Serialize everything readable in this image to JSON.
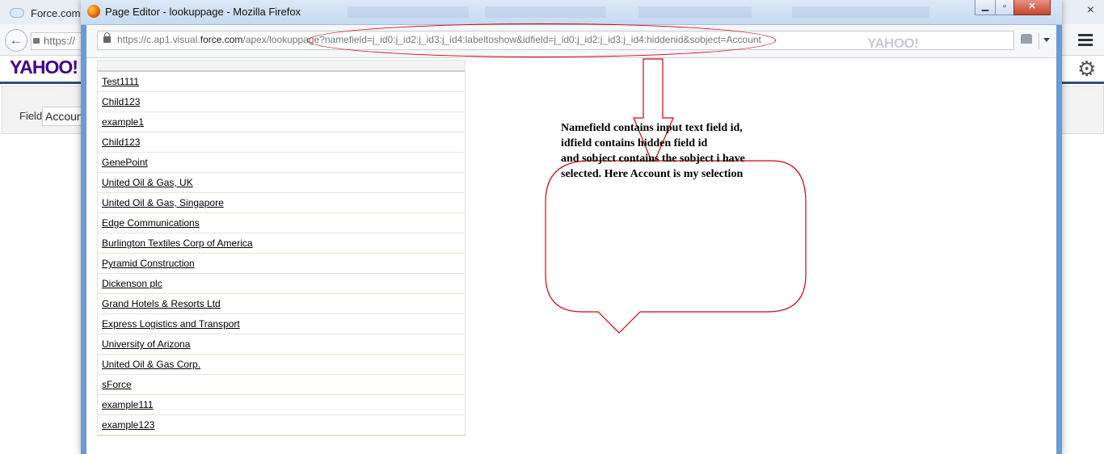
{
  "background": {
    "tab_title": "Force.com",
    "close_glyph": "×",
    "url_prefix": "https://",
    "brand": "YAHOO!",
    "field_label": "Field",
    "field_value": "Accoun"
  },
  "popup": {
    "window_title": "Page Editor - lookuppage - Mozilla Firefox",
    "url_host_pre": "https://c.ap1.visual.",
    "url_host_main": "force.com",
    "url_path": "/apex/lookuppage?namefield=j_id0:j_id2:j_id3:j_id4:labeltoshow&idfield=j_id0:j_id2:j_id3:j_id4:hiddenid&sobject=Account",
    "search_engine_label": "YAHOO!",
    "window_buttons": {
      "minimize": "▁",
      "maximize": "▫",
      "close": "✕"
    },
    "lookup_results": [
      "Test1111",
      "Child123",
      "example1",
      "Child123",
      "GenePoint",
      "United Oil & Gas, UK",
      "United Oil & Gas, Singapore",
      "Edge Communications",
      "Burlington Textiles Corp of America",
      "Pyramid Construction",
      "Dickenson plc",
      "Grand Hotels & Resorts Ltd",
      "Express Logistics and Transport",
      "University of Arizona",
      "United Oil & Gas Corp.",
      "sForce",
      "example111",
      "example123"
    ]
  },
  "annotation": {
    "line1": "Namefield contains input text field id,",
    "line2": "idfield contains hidden field id",
    "line3": "and sobject contains the sobject i have",
    "line4": "selected. Here Account is my selection",
    "stroke_color": "#d8000f"
  }
}
